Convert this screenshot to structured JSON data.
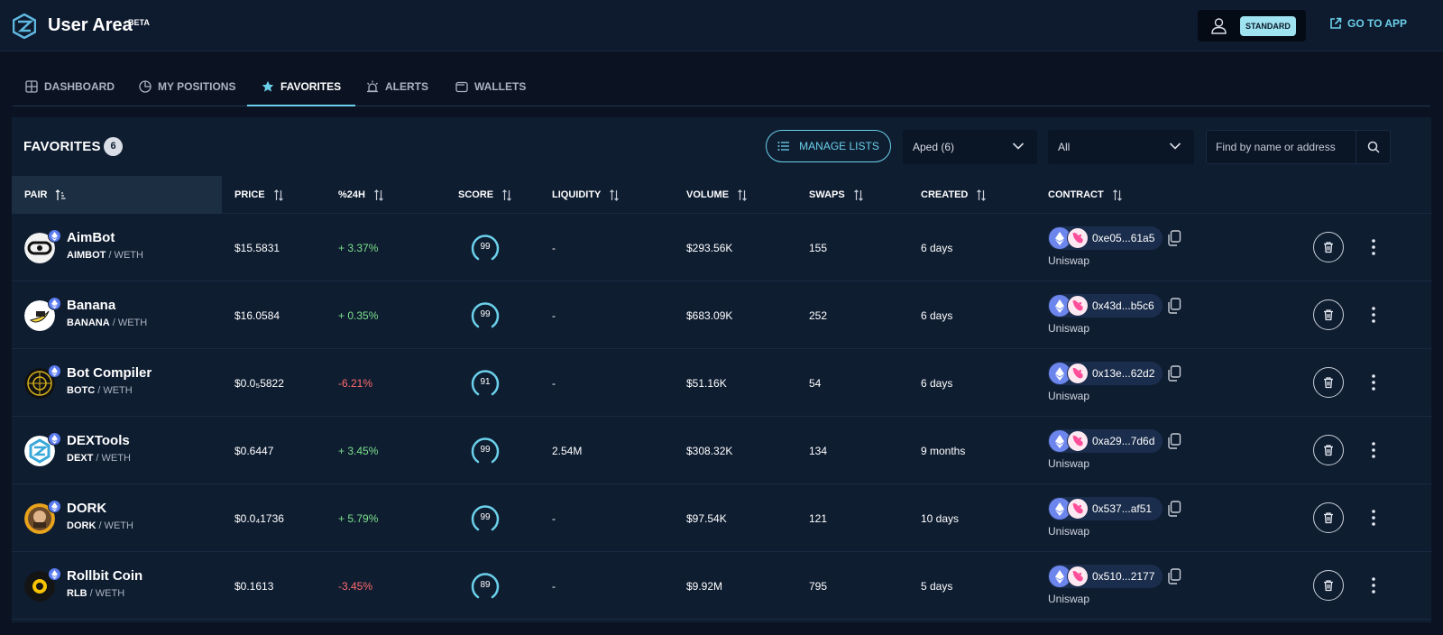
{
  "header": {
    "title": "User Area",
    "badge": "BETA",
    "plan": "STANDARD",
    "goto_app": "GO TO APP"
  },
  "tabs": [
    {
      "label": "DASHBOARD",
      "icon": "grid-icon"
    },
    {
      "label": "MY POSITIONS",
      "icon": "pie-chart-icon"
    },
    {
      "label": "FAVORITES",
      "icon": "star-icon",
      "active": true
    },
    {
      "label": "ALERTS",
      "icon": "siren-icon"
    },
    {
      "label": "WALLETS",
      "icon": "wallet-icon"
    }
  ],
  "favorites": {
    "title": "FAVORITES",
    "count": "6",
    "manage_lists": "MANAGE LISTS",
    "list_select": "Aped (6)",
    "filter_select": "All",
    "search_placeholder": "Find by name or address"
  },
  "table": {
    "headers": {
      "pair": "PAIR",
      "price": "PRICE",
      "change": "%24H",
      "score": "SCORE",
      "liquidity": "LIQUIDITY",
      "volume": "VOLUME",
      "swaps": "SWAPS",
      "created": "CREATED",
      "contract": "CONTRACT"
    },
    "rows": [
      {
        "name": "AimBot",
        "symbol": "AIMBOT",
        "quote": " / WETH",
        "price": "$15.5831",
        "change": "+ 3.37%",
        "change_dir": "up",
        "score": "99",
        "liquidity": "-",
        "volume": "$293.56K",
        "swaps": "155",
        "created": "6 days",
        "address": "0xe05...61a5",
        "dex": "Uniswap"
      },
      {
        "name": "Banana",
        "symbol": "BANANA",
        "quote": " / WETH",
        "price": "$16.0584",
        "change": "+ 0.35%",
        "change_dir": "up",
        "score": "99",
        "liquidity": "-",
        "volume": "$683.09K",
        "swaps": "252",
        "created": "6 days",
        "address": "0x43d...b5c6",
        "dex": "Uniswap"
      },
      {
        "name": "Bot Compiler",
        "symbol": "BOTC",
        "quote": " / WETH",
        "price": "$0.0₅5822",
        "change": "-6.21%",
        "change_dir": "down",
        "score": "91",
        "liquidity": "-",
        "volume": "$51.16K",
        "swaps": "54",
        "created": "6 days",
        "address": "0x13e...62d2",
        "dex": "Uniswap"
      },
      {
        "name": "DEXTools",
        "symbol": "DEXT",
        "quote": " / WETH",
        "price": "$0.6447",
        "change": "+ 3.45%",
        "change_dir": "up",
        "score": "99",
        "liquidity": "2.54M",
        "volume": "$308.32K",
        "swaps": "134",
        "created": "9 months",
        "address": "0xa29...7d6d",
        "dex": "Uniswap"
      },
      {
        "name": "DORK",
        "symbol": "DORK",
        "quote": " / WETH",
        "price": "$0.0₄1736",
        "change": "+ 5.79%",
        "change_dir": "up",
        "score": "99",
        "liquidity": "-",
        "volume": "$97.54K",
        "swaps": "121",
        "created": "10 days",
        "address": "0x537...af51",
        "dex": "Uniswap"
      },
      {
        "name": "Rollbit Coin",
        "symbol": "RLB",
        "quote": " / WETH",
        "price": "$0.1613",
        "change": "-3.45%",
        "change_dir": "down",
        "score": "89",
        "liquidity": "-",
        "volume": "$9.92M",
        "swaps": "795",
        "created": "5 days",
        "address": "0x510...2177",
        "dex": "Uniswap"
      }
    ]
  },
  "colors": {
    "accent": "#6bd0ea",
    "positive": "#7be08b",
    "negative": "#ff6b6b",
    "background": "#0b1322",
    "panel": "#0f1d31"
  }
}
